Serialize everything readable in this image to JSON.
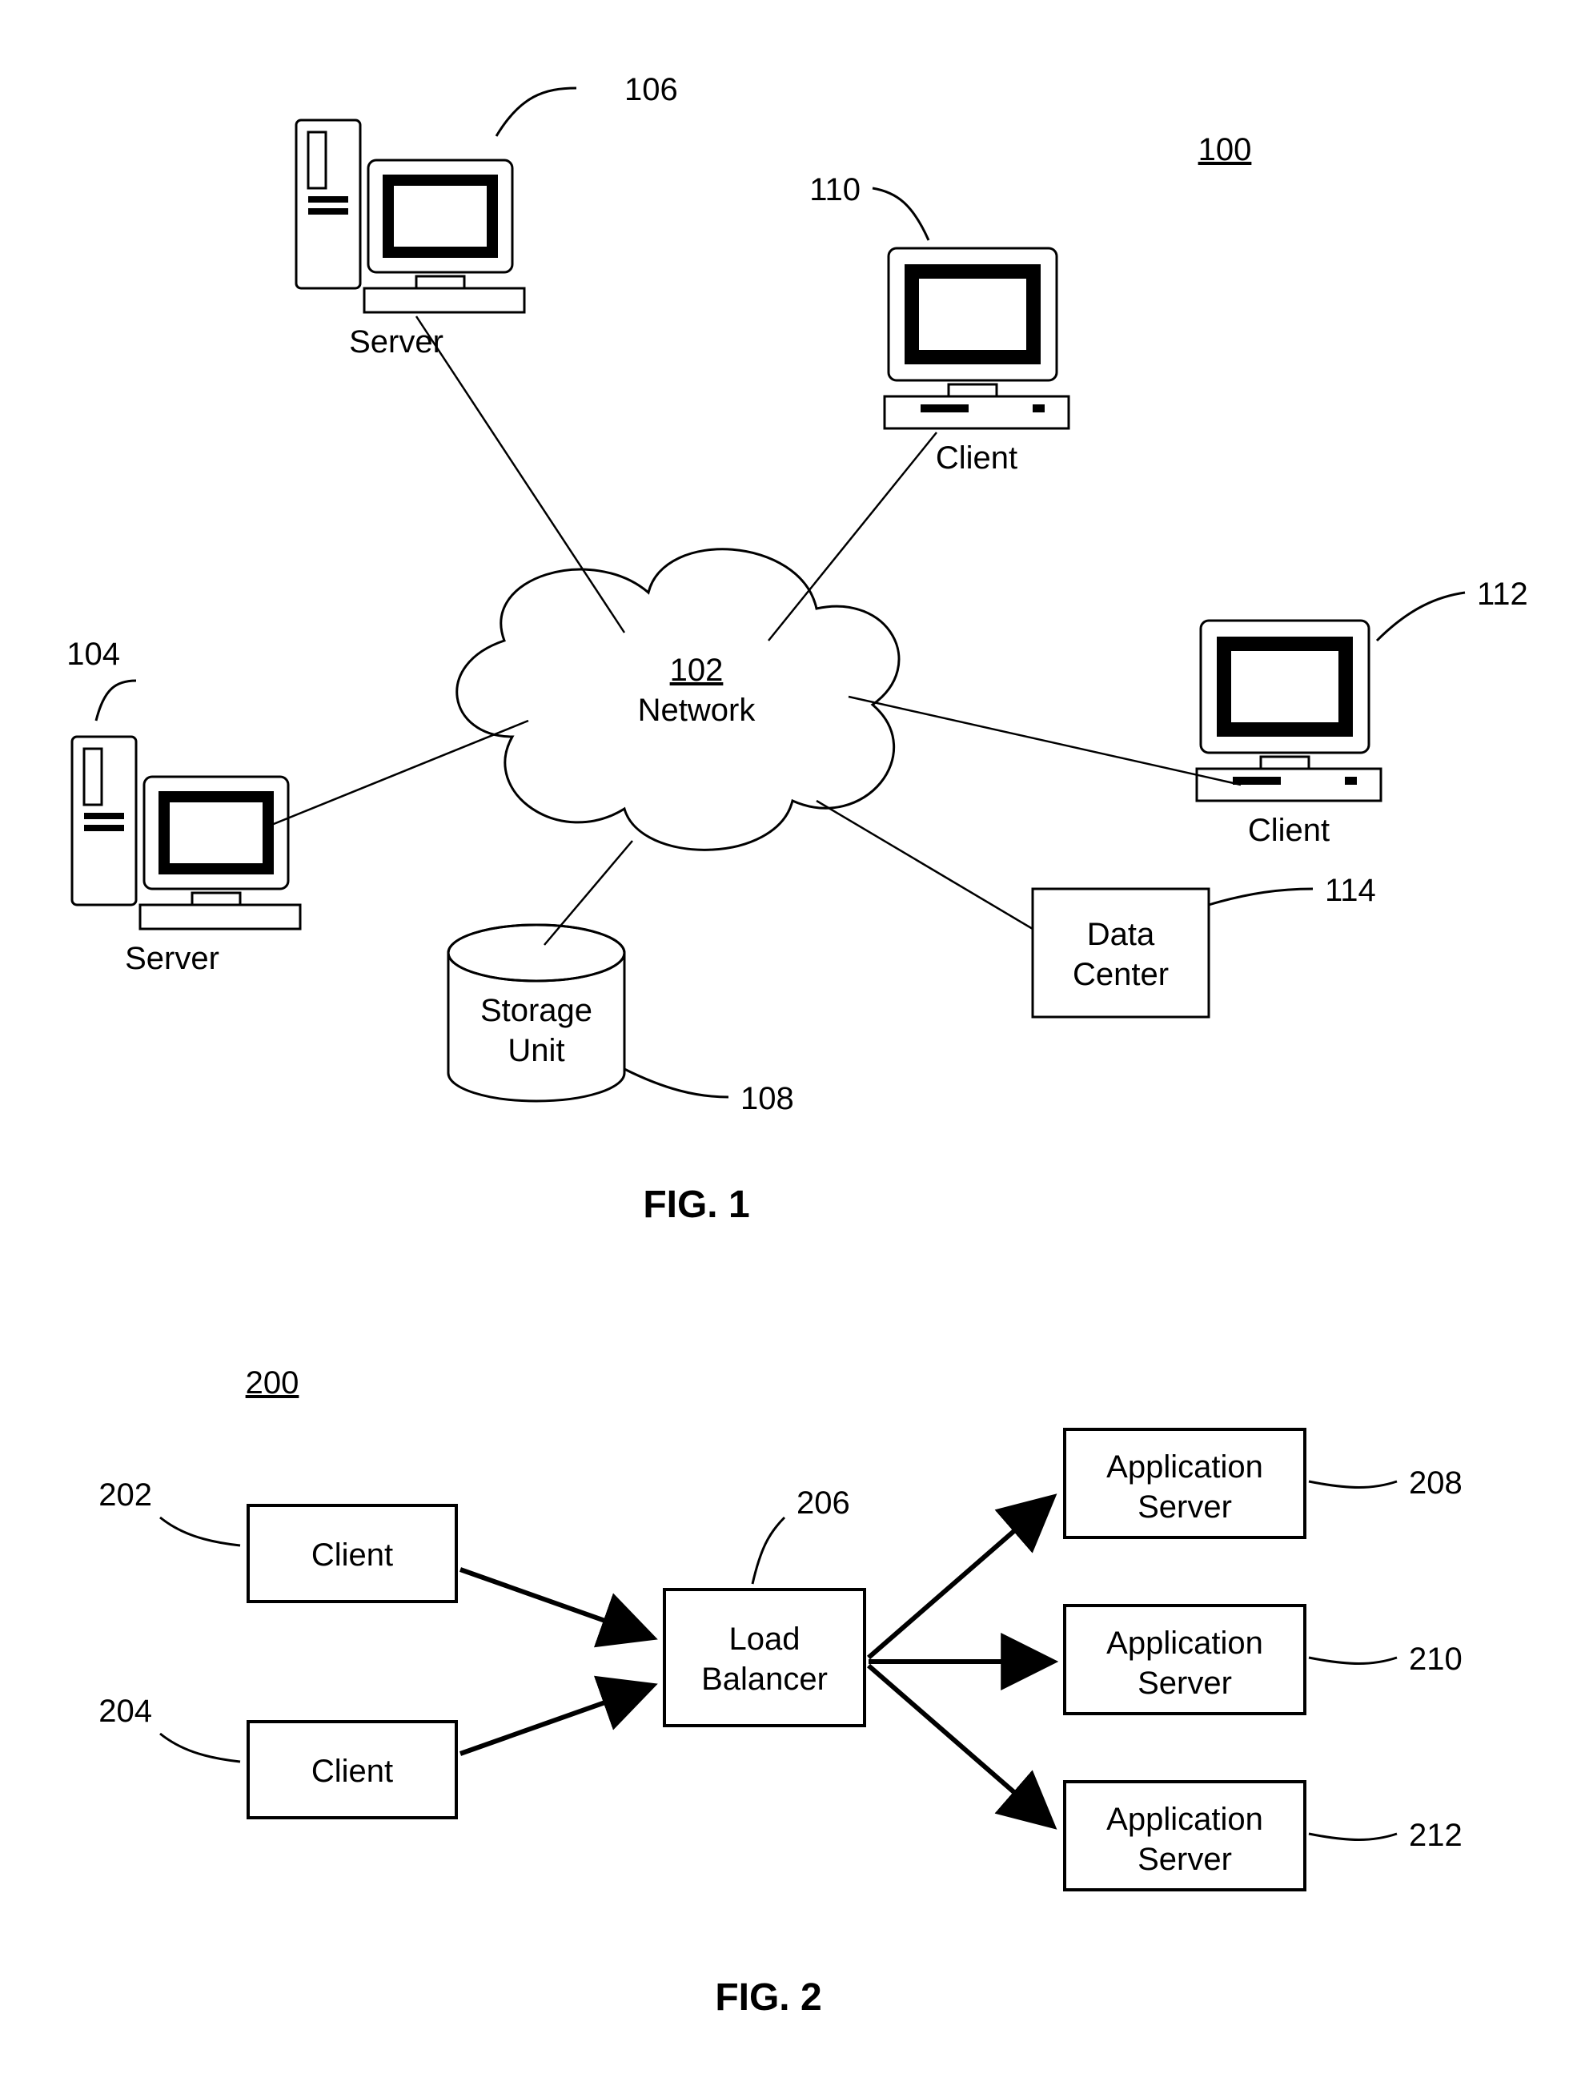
{
  "fig1": {
    "id": "100",
    "title": "FIG. 1",
    "network": {
      "ref": "102",
      "label": "Network"
    },
    "server1": {
      "ref": "104",
      "label": "Server"
    },
    "server2": {
      "ref": "106",
      "label": "Server"
    },
    "storage": {
      "ref": "108",
      "label": "Storage\nUnit"
    },
    "client1": {
      "ref": "110",
      "label": "Client"
    },
    "client2": {
      "ref": "112",
      "label": "Client"
    },
    "datacenter": {
      "ref": "114",
      "label": "Data\nCenter"
    }
  },
  "fig2": {
    "id": "200",
    "title": "FIG. 2",
    "clientA": {
      "ref": "202",
      "label": "Client"
    },
    "clientB": {
      "ref": "204",
      "label": "Client"
    },
    "lb": {
      "ref": "206",
      "label": "Load\nBalancer"
    },
    "app1": {
      "ref": "208",
      "label": "Application\nServer"
    },
    "app2": {
      "ref": "210",
      "label": "Application\nServer"
    },
    "app3": {
      "ref": "212",
      "label": "Application\nServer"
    }
  }
}
